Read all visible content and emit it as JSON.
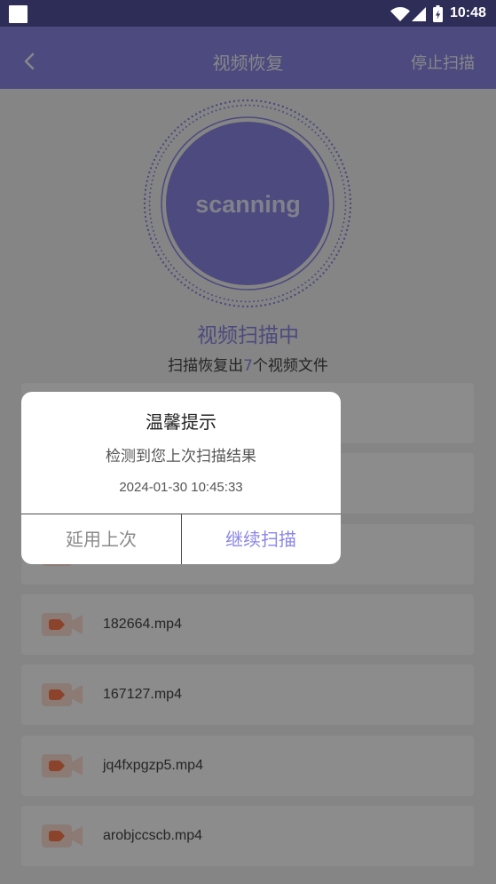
{
  "status_bar": {
    "notification_icon": "notification-icon",
    "wifi_icon": "wifi-icon",
    "signal_icon": "cellular-signal-icon",
    "battery_icon": "battery-charging-icon",
    "time": "10:48"
  },
  "app_bar": {
    "back_icon": "chevron-left-icon",
    "title": "视频恢复",
    "action_label": "停止扫描"
  },
  "scanner": {
    "label": "scanning",
    "status": "视频扫描中",
    "summary_prefix": "扫描恢复出",
    "summary_count": 7,
    "summary_suffix": "个视频文件"
  },
  "files": [
    {
      "icon": "video-file-icon"
    },
    {
      "icon": "video-file-icon"
    },
    {
      "icon": "video-file-icon"
    },
    {
      "icon": "video-file-icon",
      "name": "182664.mp4"
    },
    {
      "icon": "video-file-icon",
      "name": "167127.mp4"
    },
    {
      "icon": "video-file-icon",
      "name": "jq4fxpgzp5.mp4"
    },
    {
      "icon": "video-file-icon",
      "name": "arobjccscb.mp4"
    }
  ],
  "dialog": {
    "title": "温馨提示",
    "message": "检测到您上次扫描结果",
    "timestamp": "2024-01-30 10:45:33",
    "cancel_label": "延用上次",
    "confirm_label": "继续扫描"
  },
  "colors": {
    "status_bar": "#2e2d57",
    "accent": "#8b87e6",
    "page_background": "#f2f2f2",
    "card": "#ffffff",
    "video_icon": "#ff7a4f",
    "video_icon_background": "#ffe1d6",
    "scrim": "rgba(0,0,0,0.45)"
  }
}
